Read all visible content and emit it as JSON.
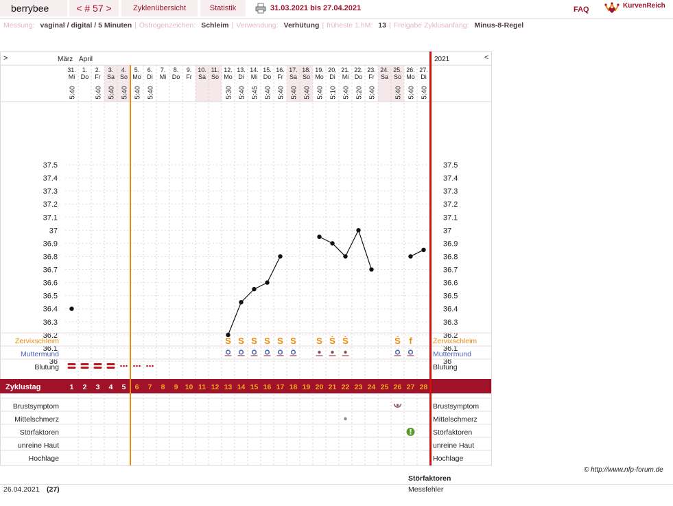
{
  "header": {
    "user": "berrybee",
    "cycle_nav": "< # 57 >",
    "overview_tab": "Zyklenübersicht",
    "stats_tab": "Statistik",
    "print_icon": "printer-icon",
    "date_range": "31.03.2021 bis 27.04.2021",
    "faq": "FAQ",
    "logo_text": "KurvenReich",
    "logo_icon": "crown-heart-icon"
  },
  "info": {
    "measurement_label": "Messung:",
    "measurement_value": "vaginal / digital / 5 Minuten",
    "estrogen_label": "Östrogenzeichen:",
    "estrogen_value": "Schleim",
    "usage_label": "Verwendung:",
    "usage_value": "Verhütung",
    "earliest_label": "früheste 1.hM:",
    "earliest_value": "13",
    "release_label": "Freigabe Zyklusanfang:",
    "release_value": "Minus-8-Regel"
  },
  "chart_data": {
    "type": "line",
    "prev_arrow": ">",
    "next_arrow": "<",
    "month_labels": [
      "März",
      "April"
    ],
    "year_label": "2021",
    "dates": [
      "31.",
      "1.",
      "2.",
      "3.",
      "4.",
      "5.",
      "6.",
      "7.",
      "8.",
      "9.",
      "10.",
      "11.",
      "12.",
      "13.",
      "14.",
      "15.",
      "16.",
      "17.",
      "18.",
      "19.",
      "20.",
      "21.",
      "22.",
      "23.",
      "24.",
      "25.",
      "26.",
      "27."
    ],
    "weekdays": [
      "Mi",
      "Do",
      "Fr",
      "Sa",
      "So",
      "Mo",
      "Di",
      "Mi",
      "Do",
      "Fr",
      "Sa",
      "So",
      "Mo",
      "Di",
      "Mi",
      "Do",
      "Fr",
      "Sa",
      "So",
      "Mo",
      "Di",
      "Mi",
      "Do",
      "Fr",
      "Sa",
      "So",
      "Mo",
      "Di"
    ],
    "times": [
      "5:40",
      "",
      "5:40",
      "5:40",
      "5:40",
      "5:40",
      "5:40",
      "",
      "",
      "",
      "",
      "",
      "5:30",
      "5:40",
      "5:45",
      "5:40",
      "5:40",
      "5:40",
      "5:40",
      "5:40",
      "5:10",
      "5:40",
      "5:20",
      "5:40",
      "",
      "5:40",
      "5:40",
      "5:40"
    ],
    "temps": [
      36.4,
      null,
      null,
      null,
      null,
      null,
      null,
      null,
      null,
      null,
      null,
      null,
      36.2,
      36.45,
      36.55,
      36.6,
      36.8,
      null,
      null,
      36.95,
      36.9,
      36.8,
      37.0,
      36.7,
      null,
      null,
      36.8,
      36.85
    ],
    "segments": [
      [
        12,
        16
      ],
      [
        19,
        23
      ],
      [
        26,
        27
      ]
    ],
    "y_ticks": [
      "37.5",
      "37.4",
      "37.3",
      "37.2",
      "37.1",
      "37",
      "36.9",
      "36.8",
      "36.7",
      "36.6",
      "36.5",
      "36.4",
      "36.3",
      "36.2",
      "36.1",
      "36"
    ],
    "ylim": [
      36.0,
      37.5
    ],
    "period_start_after_day": 5,
    "mucus": [
      "",
      "",
      "",
      "",
      "",
      "",
      "",
      "",
      "",
      "",
      "",
      "",
      "Ṡ",
      "S",
      "S",
      "S",
      "S",
      "S",
      "",
      "S",
      "Ṡ",
      "Ṡ",
      "",
      "",
      "",
      "Ṡ",
      "f",
      ""
    ],
    "cervix": [
      "",
      "",
      "",
      "",
      "",
      "",
      "",
      "",
      "",
      "",
      "",
      "",
      "o",
      "o",
      "o",
      "o",
      "o",
      "o",
      "",
      "-",
      "-",
      "-",
      "",
      "",
      "",
      "o",
      "o",
      ""
    ],
    "bleeding": [
      2,
      2,
      2,
      2,
      1,
      1,
      1,
      0,
      0,
      0,
      0,
      0,
      0,
      0,
      0,
      0,
      0,
      0,
      0,
      0,
      0,
      0,
      0,
      0,
      0,
      0,
      0,
      0
    ],
    "cycle_label": "Zyklustag",
    "cycle_days": [
      "1",
      "2",
      "3",
      "4",
      "5",
      "6",
      "7",
      "8",
      "9",
      "10",
      "11",
      "12",
      "13",
      "14",
      "15",
      "16",
      "17",
      "18",
      "19",
      "20",
      "21",
      "22",
      "23",
      "24",
      "25",
      "26",
      "27",
      "28"
    ],
    "rows": {
      "mucus": "Zervixschleim",
      "cervix": "Muttermund",
      "bleeding": "Blutung",
      "breast": "Brustsymptom",
      "midpain": "Mittelschmerz",
      "disturb": "Störfaktoren",
      "skin": "unreine Haut",
      "mood": "Hochlage"
    },
    "breast_day_index": 25,
    "midpain_day_index": 21,
    "disturb_day_index": 26,
    "weekend_indices": [
      3,
      4,
      10,
      11,
      17,
      18,
      24,
      25
    ]
  },
  "footer": {
    "copyright": "© http://www.nfp-forum.de",
    "date": "26.04.2021",
    "count": "(27)",
    "disturb_heading": "Störfaktoren",
    "disturb_value": "Messfehler"
  },
  "colors": {
    "accent": "#a0122a",
    "orange": "#e98a10",
    "blue": "#4a64b8",
    "weekend": "#f4e8ea",
    "green": "#5c9a2e"
  }
}
